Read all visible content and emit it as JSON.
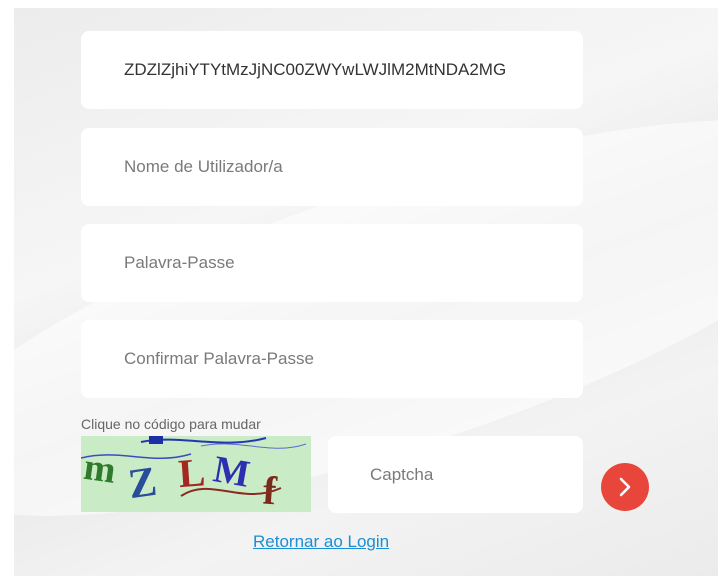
{
  "form": {
    "token_value": "ZDZlZjhiYTYtMzJjNC00ZWYwLWJlM2MtNDA2MG",
    "username_placeholder": "Nome de Utilizador/a",
    "password_placeholder": "Palavra-Passe",
    "confirm_password_placeholder": "Confirmar Palavra-Passe"
  },
  "captcha": {
    "hint": "Clique no código para mudar",
    "code_chars": [
      "m",
      "Z",
      "L",
      "M",
      "f"
    ],
    "input_placeholder": "Captcha"
  },
  "submit": {
    "icon": "chevron-right-icon",
    "color": "#e8463a"
  },
  "return_link": "Retornar ao Login"
}
